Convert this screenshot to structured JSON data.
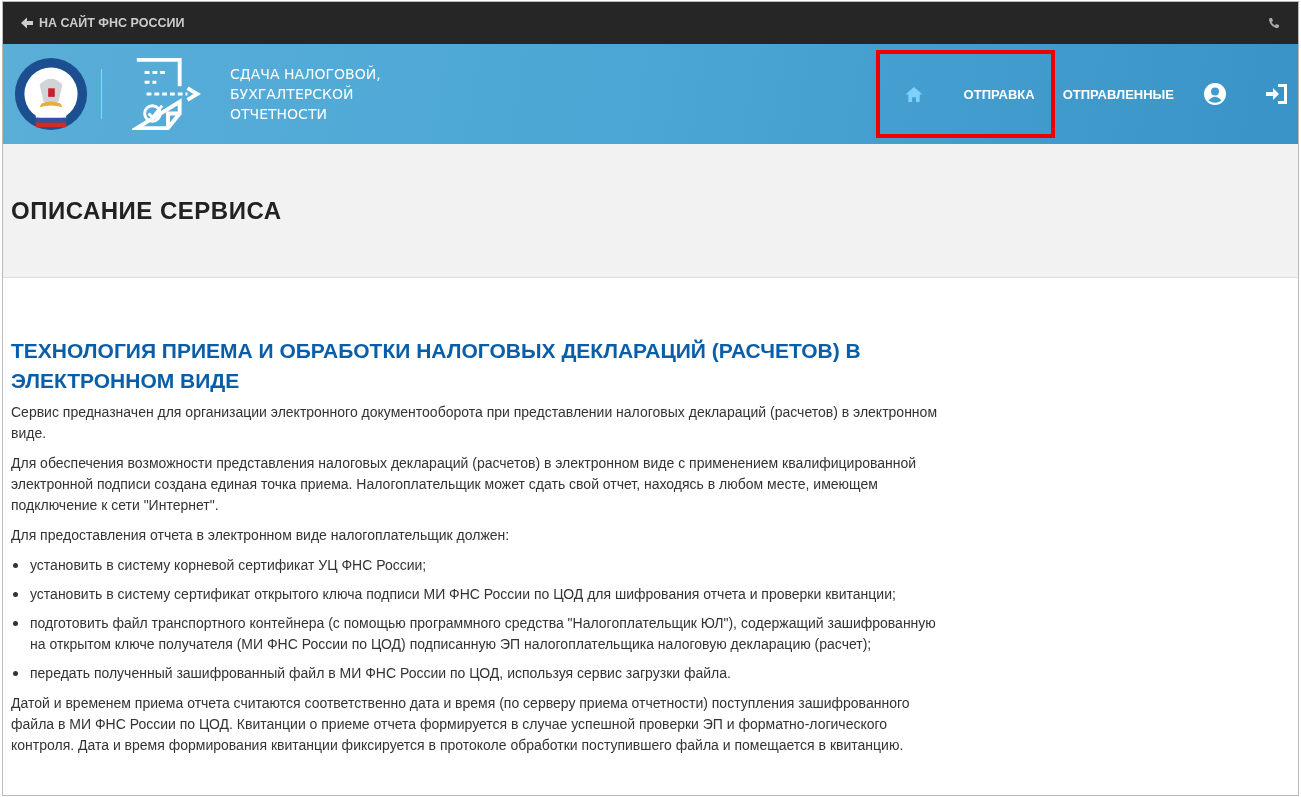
{
  "top_bar": {
    "back_link": "НА САЙТ ФНС РОССИИ"
  },
  "header": {
    "service_title_lines": [
      "СДАЧА НАЛОГОВОЙ,",
      "БУХГАЛТЕРСКОЙ",
      "ОТЧЕТНОСТИ"
    ]
  },
  "nav": {
    "items": [
      {
        "kind": "home",
        "selected": true,
        "framed": true
      },
      {
        "kind": "link",
        "label": "ОТПРАВКА",
        "selected": false,
        "framed": true
      },
      {
        "kind": "link",
        "label": "ОТПРАВЛЕННЫЕ",
        "selected": false,
        "framed": false
      },
      {
        "kind": "user",
        "selected": false,
        "framed": false
      },
      {
        "kind": "logout",
        "selected": false,
        "framed": false
      }
    ]
  },
  "page_title": "ОПИСАНИЕ СЕРВИСА",
  "content": [
    {
      "kind": "heading",
      "text": "ТЕХНОЛОГИЯ ПРИЕМА И ОБРАБОТКИ НАЛОГОВЫХ ДЕКЛАРАЦИЙ (РАСЧЕТОВ) В ЭЛЕКТРОННОМ ВИДЕ"
    },
    {
      "kind": "paragraph",
      "text": "Сервис предназначен для организации электронного документооборота при представлении налоговых деклараций (расчетов) в электронном виде."
    },
    {
      "kind": "paragraph",
      "text": "Для обеспечения возможности представления налоговых деклараций (расчетов) в электронном виде с применением квалифицированной электронной подписи создана единая точка приема. Налогоплательщик может сдать свой отчет, находясь в любом месте, имеющем подключение к сети \"Интернет\"."
    },
    {
      "kind": "paragraph",
      "text": "Для предоставления отчета в электронном виде налогоплательщик должен:"
    },
    {
      "kind": "list",
      "items": [
        "установить в систему корневой сертификат УЦ ФНС России;",
        "установить в систему сертификат открытого ключа подписи МИ ФНС России по ЦОД для шифрования отчета и проверки квитанции;",
        "подготовить файл транспортного контейнера (с помощью программного средства \"Налогоплательщик ЮЛ\"), содержащий зашифрованную на открытом ключе получателя (МИ ФНС России по ЦОД) подписанную ЭП налогоплательщика налоговую декларацию (расчет);",
        "передать полученный зашифрованный файл в МИ ФНС России по ЦОД, используя сервис загрузки файла."
      ]
    },
    {
      "kind": "paragraph",
      "text": "Датой и временем приема отчета считаются соответственно дата и время (по серверу приема отчетности) поступления зашифрованного файла в МИ ФНС России по ЦОД. Квитанции о приеме отчета формируется в случае успешной проверки ЭП и форматно-логического контроля. Дата и время формирования квитанции фиксируется в протоколе обработки поступившего файла и помещается в квитанцию."
    }
  ]
}
